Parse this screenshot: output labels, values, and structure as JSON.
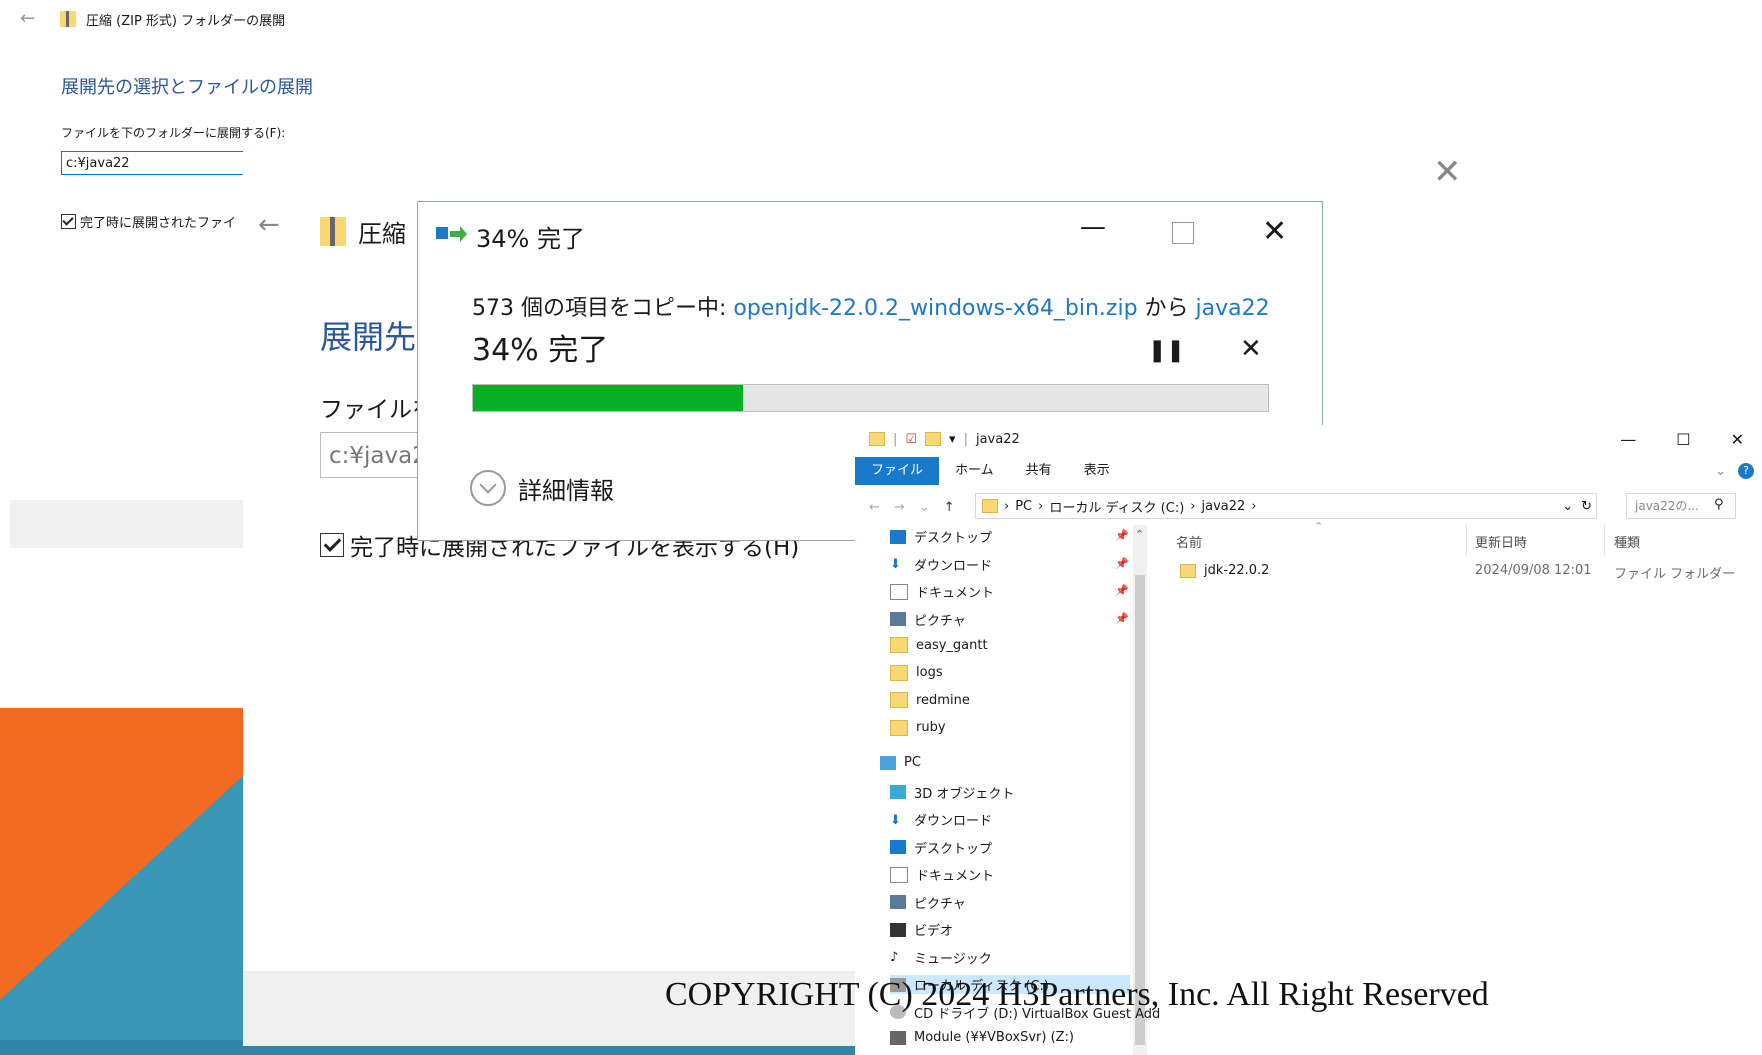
{
  "slide": {
    "copyright": "COPYRIGHT (C) 2024 H3Partners, Inc. All Right Reserved"
  },
  "extract_dialog_small": {
    "title": "圧縮 (ZIP 形式) フォルダーの展開",
    "heading": "展開先の選択とファイルの展開",
    "label": "ファイルを下のフォルダーに展開する(F):",
    "path_value": "c:¥java22",
    "checkbox_label": "完了時に展開されたファイ"
  },
  "extract_dialog_large": {
    "title": "圧縮（",
    "heading": "展開先",
    "label": "ファイルを",
    "path_value": "c:¥java2",
    "checkbox_label": "完了時に展開されたファイルを表示する(H)"
  },
  "progress_dialog": {
    "title": "34% 完了",
    "desc_prefix": "573 個の項目をコピー中: ",
    "source": "openjdk-22.0.2_windows-x64_bin.zip",
    "desc_mid": " から ",
    "dest": "java22",
    "percent_text": "34% 完了",
    "progress": 0.34,
    "details_label": "詳細情報",
    "colors": {
      "fill": "#06b025",
      "link": "#1e78c8"
    }
  },
  "explorer": {
    "window_title": "java22",
    "ribbon_tabs": [
      "ファイル",
      "ホーム",
      "共有",
      "表示"
    ],
    "breadcrumb": [
      "PC",
      "ローカル ディスク (C:)",
      "java22"
    ],
    "search_placeholder": "java22の...",
    "quick_access": [
      {
        "label": "デスクトップ",
        "icon": "desktop-icon",
        "pinned": true
      },
      {
        "label": "ダウンロード",
        "icon": "download-icon",
        "pinned": true
      },
      {
        "label": "ドキュメント",
        "icon": "document-icon",
        "pinned": true
      },
      {
        "label": "ピクチャ",
        "icon": "picture-icon",
        "pinned": true
      },
      {
        "label": "easy_gantt",
        "icon": "folder-icon",
        "pinned": false
      },
      {
        "label": "logs",
        "icon": "folder-icon",
        "pinned": false
      },
      {
        "label": "redmine",
        "icon": "folder-icon",
        "pinned": false
      },
      {
        "label": "ruby",
        "icon": "folder-icon",
        "pinned": false
      }
    ],
    "pc_label": "PC",
    "pc_items": [
      {
        "label": "3D オブジェクト",
        "icon": "3d-objects-icon"
      },
      {
        "label": "ダウンロード",
        "icon": "download-icon"
      },
      {
        "label": "デスクトップ",
        "icon": "desktop-icon"
      },
      {
        "label": "ドキュメント",
        "icon": "document-icon"
      },
      {
        "label": "ピクチャ",
        "icon": "picture-icon"
      },
      {
        "label": "ビデオ",
        "icon": "video-icon"
      },
      {
        "label": "ミュージック",
        "icon": "music-icon"
      },
      {
        "label": "ローカル ディスク (C:)",
        "icon": "disk-icon"
      },
      {
        "label": "CD ドライブ (D:) VirtualBox Guest Add",
        "icon": "cd-icon"
      },
      {
        "label": "Module (¥¥VBoxSvr) (Z:)",
        "icon": "network-drive-icon"
      }
    ],
    "columns": [
      "名前",
      "更新日時",
      "種類"
    ],
    "files": [
      {
        "name": "jdk-22.0.2",
        "modified": "2024/09/08 12:01",
        "type": "ファイル フォルダー"
      }
    ]
  }
}
